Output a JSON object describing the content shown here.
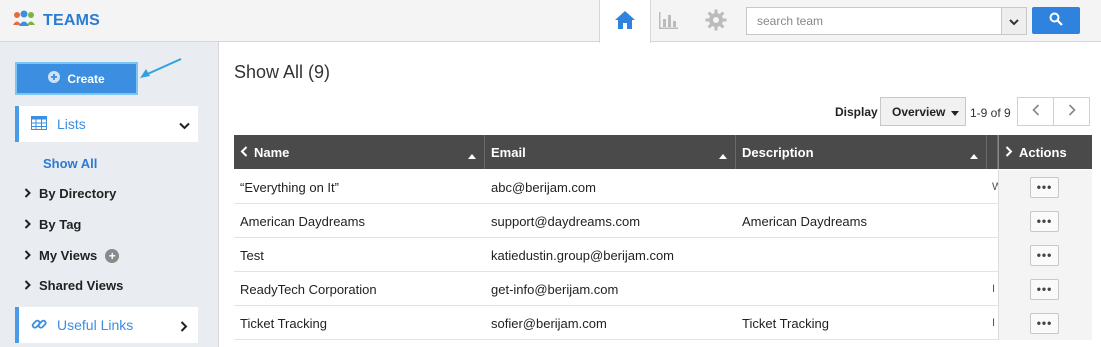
{
  "app": {
    "title": "TEAMS"
  },
  "search": {
    "placeholder": "search team"
  },
  "sidebar": {
    "create_label": "Create",
    "lists_label": "Lists",
    "items": [
      {
        "label": "Show All"
      },
      {
        "label": "By Directory"
      },
      {
        "label": "By Tag"
      },
      {
        "label": "My Views"
      },
      {
        "label": "Shared Views"
      }
    ],
    "useful_links_label": "Useful Links"
  },
  "main": {
    "title": "Show All (9)",
    "display_label": "Display",
    "display_value": "Overview",
    "page_range": "1-9 of 9"
  },
  "table": {
    "columns": [
      "Name",
      "Email",
      "Description",
      "Actions"
    ],
    "rows": [
      {
        "name": "“Everything on It”",
        "email": "abc@berijam.com",
        "description": "",
        "extra": "W",
        "action": "•••"
      },
      {
        "name": "American Daydreams",
        "email": "support@daydreams.com",
        "description": "American Daydreams",
        "extra": "",
        "action": "•••"
      },
      {
        "name": "Test",
        "email": "katiedustin.group@berijam.com",
        "description": "",
        "extra": "",
        "action": "•••"
      },
      {
        "name": "ReadyTech Corporation",
        "email": "get-info@berijam.com",
        "description": "",
        "extra": "I",
        "action": "•••"
      },
      {
        "name": "Ticket Tracking",
        "email": "sofier@berijam.com",
        "description": "Ticket Tracking",
        "extra": "I",
        "action": "•••"
      }
    ]
  },
  "colors": {
    "accent": "#2f82dd",
    "header_bg": "#4a4a4a",
    "sidebar_bg": "#e9ecf1"
  }
}
